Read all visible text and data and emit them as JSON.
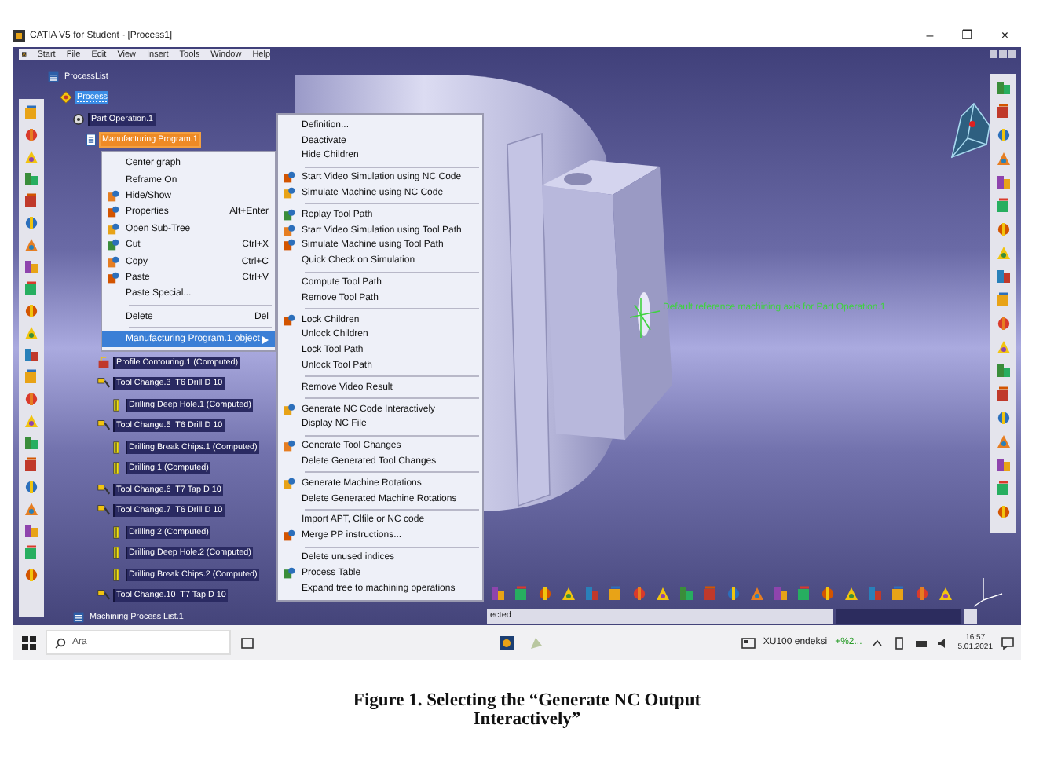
{
  "window": {
    "title": "CATIA V5 for Student - [Process1]",
    "controls": [
      "–",
      "❐",
      "×"
    ]
  },
  "menu_bar": [
    "Start",
    "File",
    "Edit",
    "View",
    "Insert",
    "Tools",
    "Window",
    "Help"
  ],
  "tree": [
    {
      "label": "ProcessList",
      "kind": "list",
      "selected": false,
      "highlighted": false,
      "context": false,
      "children": [
        {
          "label": "Process",
          "kind": "process",
          "selected": true,
          "highlighted": false,
          "context": false,
          "children": [
            {
              "label": "Part Operation.1",
              "kind": "part_operation",
              "selected": false,
              "highlighted": true,
              "context": false,
              "children": [
                {
                  "label": "Manufacturing Program.1",
                  "kind": "program",
                  "selected": false,
                  "highlighted": false,
                  "context": true,
                  "children": [
                    {
                      "label": "Profile Contouring.1 (Computed)",
                      "kind": "operation",
                      "selected": false,
                      "highlighted": true,
                      "context": false
                    },
                    {
                      "label": "Tool Change.3  T6 Drill D 10",
                      "kind": "tool_change",
                      "selected": false,
                      "highlighted": true,
                      "context": false,
                      "children": [
                        {
                          "label": "Drilling Deep Hole.1 (Computed)",
                          "kind": "drilling",
                          "selected": false,
                          "highlighted": true,
                          "context": false
                        }
                      ]
                    },
                    {
                      "label": "Tool Change.5  T6 Drill D 10",
                      "kind": "tool_change",
                      "selected": false,
                      "highlighted": true,
                      "context": false,
                      "children": [
                        {
                          "label": "Drilling Break Chips.1 (Computed)",
                          "kind": "drilling",
                          "selected": false,
                          "highlighted": true,
                          "context": false
                        },
                        {
                          "label": "Drilling.1 (Computed)",
                          "kind": "drilling",
                          "selected": false,
                          "highlighted": true,
                          "context": false
                        }
                      ]
                    },
                    {
                      "label": "Tool Change.6  T7 Tap D 10",
                      "kind": "tool_change",
                      "selected": false,
                      "highlighted": true,
                      "context": false
                    },
                    {
                      "label": "Tool Change.7  T6 Drill D 10",
                      "kind": "tool_change",
                      "selected": false,
                      "highlighted": true,
                      "context": false,
                      "children": [
                        {
                          "label": "Drilling.2 (Computed)",
                          "kind": "drilling",
                          "selected": false,
                          "highlighted": true,
                          "context": false
                        },
                        {
                          "label": "Drilling Deep Hole.2 (Computed)",
                          "kind": "drilling",
                          "selected": false,
                          "highlighted": true,
                          "context": false
                        },
                        {
                          "label": "Drilling Break Chips.2 (Computed)",
                          "kind": "drilling",
                          "selected": false,
                          "highlighted": true,
                          "context": false
                        }
                      ]
                    },
                    {
                      "label": "Tool Change.10  T7 Tap D 10",
                      "kind": "tool_change",
                      "selected": false,
                      "highlighted": true,
                      "context": false
                    }
                  ]
                }
              ]
            },
            {
              "label": "Machining Process List.1",
              "kind": "list",
              "selected": false,
              "highlighted": false,
              "context": false
            }
          ]
        }
      ]
    }
  ],
  "context_menu": {
    "groups": [
      [
        {
          "label": "Center graph",
          "icon": false,
          "selected": false,
          "submenu": false
        },
        {
          "label": "Reframe On",
          "icon": false,
          "selected": false,
          "submenu": false
        },
        {
          "label": "Hide/Show",
          "icon": true,
          "selected": false,
          "submenu": false
        },
        {
          "label": "Properties",
          "shortcut": "Alt+Enter",
          "icon": true,
          "selected": false,
          "submenu": false
        },
        {
          "label": "Open Sub-Tree",
          "icon": true,
          "selected": false,
          "submenu": false
        },
        {
          "label": "Cut",
          "shortcut": "Ctrl+X",
          "icon": true,
          "selected": false,
          "submenu": false
        },
        {
          "label": "Copy",
          "shortcut": "Ctrl+C",
          "icon": true,
          "selected": false,
          "submenu": false
        },
        {
          "label": "Paste",
          "shortcut": "Ctrl+V",
          "icon": true,
          "selected": false,
          "submenu": false
        },
        {
          "label": "Paste Special...",
          "icon": false,
          "selected": false,
          "submenu": false
        }
      ],
      [
        {
          "label": "Delete",
          "shortcut": "Del",
          "icon": false,
          "selected": false,
          "submenu": false
        }
      ],
      [
        {
          "label": "Manufacturing Program.1 object",
          "icon": false,
          "selected": true,
          "submenu": true
        }
      ]
    ]
  },
  "submenu": {
    "groups": [
      [
        {
          "label": "Definition...",
          "icon": false
        },
        {
          "label": "Deactivate",
          "icon": false
        },
        {
          "label": "Hide Children",
          "icon": false
        }
      ],
      [
        {
          "label": "Start Video Simulation using NC Code",
          "icon": true
        },
        {
          "label": "Simulate Machine using NC Code",
          "icon": true
        }
      ],
      [
        {
          "label": "Replay Tool Path",
          "icon": true
        },
        {
          "label": "Start Video Simulation using Tool Path",
          "icon": true
        },
        {
          "label": "Simulate Machine using Tool Path",
          "icon": true
        },
        {
          "label": "Quick Check on Simulation",
          "icon": false
        }
      ],
      [
        {
          "label": "Compute Tool Path",
          "icon": false
        },
        {
          "label": "Remove Tool Path",
          "icon": false
        }
      ],
      [
        {
          "label": "Lock Children",
          "icon": true
        },
        {
          "label": "Unlock Children",
          "icon": false
        },
        {
          "label": "Lock Tool Path",
          "icon": false
        },
        {
          "label": "Unlock Tool Path",
          "icon": false
        }
      ],
      [
        {
          "label": "Remove Video Result",
          "icon": false
        }
      ],
      [
        {
          "label": "Generate NC Code Interactively",
          "icon": true
        },
        {
          "label": "Display NC File",
          "icon": false
        }
      ],
      [
        {
          "label": "Generate Tool Changes",
          "icon": true
        },
        {
          "label": "Delete Generated Tool Changes",
          "icon": false
        }
      ],
      [
        {
          "label": "Generate Machine Rotations",
          "icon": true
        },
        {
          "label": "Delete Generated Machine Rotations",
          "icon": false
        }
      ],
      [
        {
          "label": "Import APT, Clfile or NC code",
          "icon": false
        },
        {
          "label": "Merge PP instructions...",
          "icon": true
        }
      ],
      [
        {
          "label": "Delete unused indices",
          "icon": false
        },
        {
          "label": "Process Table",
          "icon": true
        },
        {
          "label": "Expand tree to machining operations",
          "icon": false
        }
      ]
    ]
  },
  "annotation": "Default reference machining axis for Part Operation.1",
  "status_bar": {
    "text": "ected"
  },
  "taskbar": {
    "search_placeholder": "Ara",
    "ticker": "XU100 endeksi",
    "ticker_change": "+%2...",
    "time": "16:57",
    "date": "5.01.2021"
  },
  "caption": "Figure 1. Selecting the “Generate NC Output Interactively”"
}
